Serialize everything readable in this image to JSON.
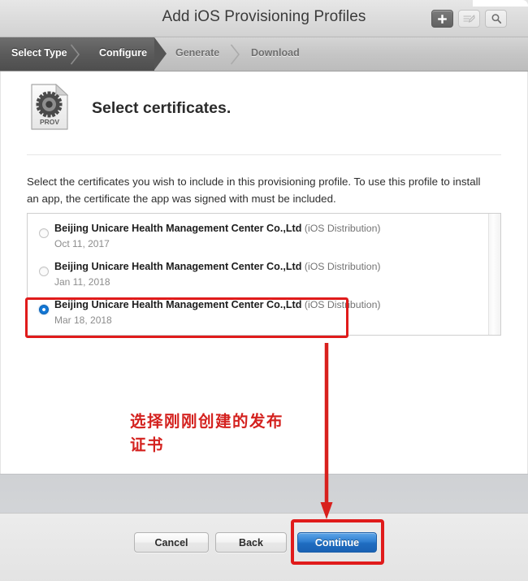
{
  "window": {
    "title": "Add iOS Provisioning Profiles"
  },
  "titlebar_buttons": [
    {
      "name": "add-button",
      "icon": "plus-icon",
      "label": "+",
      "state": "active"
    },
    {
      "name": "edit-button",
      "icon": "pencil-icon",
      "label": "",
      "state": "disabled"
    },
    {
      "name": "search-button",
      "icon": "search-icon",
      "label": "",
      "state": "normal"
    }
  ],
  "steps": [
    {
      "label": "Select Type",
      "state": "done"
    },
    {
      "label": "Configure",
      "state": "current"
    },
    {
      "label": "Generate",
      "state": "todo"
    },
    {
      "label": "Download",
      "state": "todo"
    }
  ],
  "main": {
    "icon_label": "PROV",
    "heading": "Select certificates.",
    "description": "Select the certificates you wish to include in this provisioning profile. To use this profile to install an app, the certificate the app was signed with must be included."
  },
  "certificates": [
    {
      "name": "Beijing Unicare Health Management Center Co.,Ltd",
      "kind": "(iOS Distribution)",
      "date": "Oct 11, 2017",
      "selected": false
    },
    {
      "name": "Beijing Unicare Health Management Center Co.,Ltd",
      "kind": "(iOS Distribution)",
      "date": "Jan 11, 2018",
      "selected": false
    },
    {
      "name": "Beijing Unicare Health Management Center Co.,Ltd",
      "kind": "(iOS Distribution)",
      "date": "Mar 18, 2018",
      "selected": true
    }
  ],
  "annotations": {
    "text": "选择刚刚创建的发布证书",
    "color": "#d4221f",
    "box_color": "#e01b1b"
  },
  "footer": {
    "cancel_label": "Cancel",
    "back_label": "Back",
    "continue_label": "Continue",
    "continue_color": "#1f6cc0"
  }
}
